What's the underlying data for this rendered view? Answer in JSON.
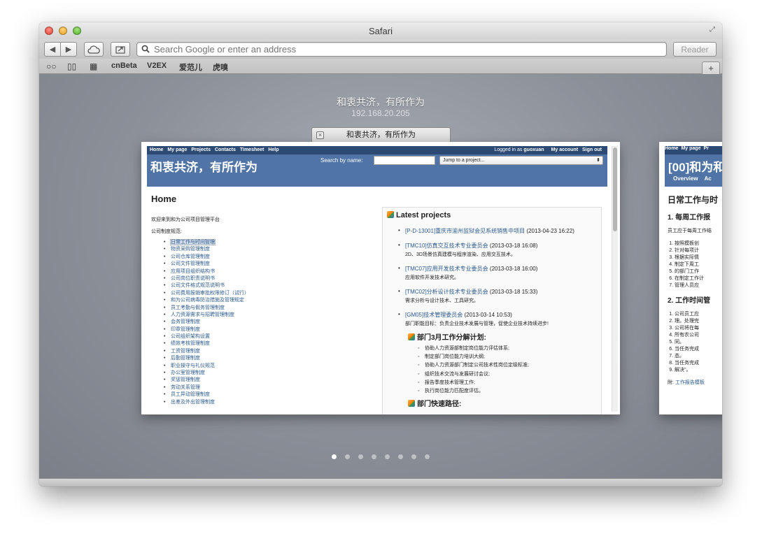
{
  "window": {
    "title": "Safari"
  },
  "toolbar": {
    "address_placeholder": "Search Google or enter an address",
    "reader_label": "Reader",
    "new_tab_label": "+"
  },
  "bookmarks": [
    "cnBeta",
    "V2EX",
    "爱范儿",
    "虎嗅"
  ],
  "top_sites": {
    "heading": "和衷共济，有所作为",
    "ip": "192.168.20.205"
  },
  "active_tab": {
    "label": "和衷共济，有所作为",
    "top_menu": [
      "Home",
      "My page",
      "Projects",
      "Contacts",
      "Timesheet",
      "Help"
    ],
    "logged_in_prefix": "Logged in as",
    "username": "guoxuan",
    "account_links": [
      "My account",
      "Sign out"
    ],
    "site_title": "和衷共济，有所作为",
    "search_label": "Search by name:",
    "project_select": "Jump to a project...",
    "page_title": "Home",
    "welcome": "欢迎来到和为公司项目管理平台",
    "rules_label": "公司制度规范:",
    "rules": [
      "日常工作与时间管理",
      "物资采购管理制度",
      "公司仓库管理制度",
      "公司文件管理制度",
      "应用项目组织结构书",
      "公司岗位职责说明书",
      "公司文件格式规范说明书",
      "公司费用报销审批权限修订（试行）",
      "和为公司病毒防治措施及管理规定",
      "员工考勤与假务管理制度",
      "人力资源需求与招聘管理制度",
      "会务管理制度",
      "印章管理制度",
      "公司组织架构设置",
      "绩效考核管理制度",
      "工资管理制度",
      "后勤管理制度",
      "职业操守与礼仪规范",
      "办公室管理制度",
      "奖惩管理制度",
      "劳动关系管理",
      "员工异动管理制度",
      "出差及外出管理制度"
    ],
    "latest_projects_title": "Latest projects",
    "projects": [
      {
        "name": "[P-D-13001]重庆市渝州监狱会见系统销售中项目",
        "date": "(2013-04-23 16:22)",
        "desc": ""
      },
      {
        "name": "[TMC10]仿真交互技术专业委员会",
        "date": "(2013-03-18 16:08)",
        "desc": "2D、3D场景仿真建模与程序渲染、应用交互技术。"
      },
      {
        "name": "[TMC07]应用开发技术专业委员会",
        "date": "(2013-03-18 16:00)",
        "desc": "应用软件开发技术研究。"
      },
      {
        "name": "[TMC02]分析设计技术专业委员会",
        "date": "(2013-03-18 15:33)",
        "desc": "需求分析与设计技术、工具研究。"
      },
      {
        "name": "[GM05]技术管理委员会",
        "date": "(2013-03-14 10:53)",
        "desc": "部门职能目标：负责企业技术发展与管理，促使企业技术持续进步!"
      }
    ],
    "dept_plan_title": "部门3月工作分解计划:",
    "dept_plan": [
      "协助人力资源部制定岗位能力评估体系;",
      "制定部门岗位能力培训大纲;",
      "协助人力资源部门制定公司技术性岗位定级标准;",
      "组织技术交流与发展研讨会议;",
      "报告季度技术管理工作;",
      "执行岗位能力匹配度评估。"
    ],
    "quick_path_title": "部门快速路径:"
  },
  "next_tab": {
    "top_menu": [
      "Home",
      "My page",
      "Pr"
    ],
    "site_title": "[00]和为和",
    "nav": [
      "Overview",
      "Ac"
    ],
    "page_title": "日常工作与时",
    "section1": "1. 每周工作报",
    "para1": "员工应于每周工作结",
    "list1": [
      "按照模板创",
      "针对每项计",
      "根据实际情",
      "制定下周工",
      "的部门工作",
      "在制定工作计",
      "管理人员应"
    ],
    "section2": "2. 工作时间管",
    "list2": [
      "公司员工应",
      "理。处理完",
      "公司将在每",
      "所有农公司",
      "同。",
      "当任务完成",
      "态。",
      "当任务完成",
      "解决\"。"
    ],
    "footer_prefix": "附:",
    "footer_link": "工作报告模板"
  },
  "pager": {
    "count": 8,
    "active_index": 0
  }
}
